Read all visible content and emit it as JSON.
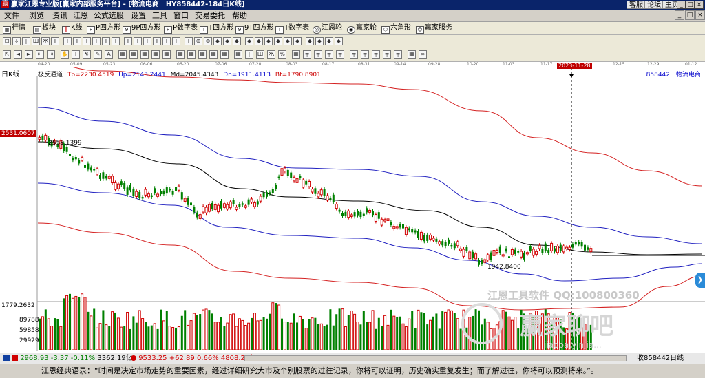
{
  "window": {
    "title": "赢家江恩专业版[赢家内部服务平台] - [物流电商　HY858442-184日K线]",
    "app_icon": "赢",
    "links": [
      "客服",
      "论坛",
      "主页"
    ],
    "controls": [
      "_",
      "□",
      "×"
    ]
  },
  "menu": {
    "items": [
      "文件",
      "浏览",
      "资讯",
      "江恩",
      "公式选股",
      "设置",
      "工具",
      "窗口",
      "交易委托",
      "帮助"
    ],
    "mdi_controls": [
      "_",
      "□",
      "×"
    ]
  },
  "toolbar1": {
    "items": [
      {
        "label": "行情",
        "icon": "quotes-icon"
      },
      {
        "label": "板块",
        "icon": "sector-icon"
      },
      {
        "label": "K线",
        "icon": "kline-icon"
      },
      {
        "label": "P四方形",
        "icon": "square-p-icon"
      },
      {
        "label": "9P四方形",
        "icon": "square-9p-icon"
      },
      {
        "label": "P数字表",
        "icon": "number-table-p-icon"
      },
      {
        "label": "T四方形",
        "icon": "square-t-icon"
      },
      {
        "label": "9T四方形",
        "icon": "square-9t-icon"
      },
      {
        "label": "T数字表",
        "icon": "number-table-t-icon"
      },
      {
        "label": "江恩轮",
        "icon": "gann-wheel-icon"
      },
      {
        "label": "赢家轮",
        "icon": "winner-wheel-icon"
      },
      {
        "label": "六角形",
        "icon": "hexagon-icon"
      },
      {
        "label": "赢家服务",
        "icon": "winner-service-icon"
      }
    ]
  },
  "chart": {
    "period_label": "日K线",
    "indicator_name": "极反通道",
    "indicators": [
      {
        "label": "Tp=2230.4519",
        "color": "#cc0000"
      },
      {
        "label": "Up=2143.2441",
        "color": "#0000cc"
      },
      {
        "label": "Md=2045.4343",
        "color": "#000000"
      },
      {
        "label": "Dn=1911.4113",
        "color": "#0000cc"
      },
      {
        "label": "Bt=1790.8901",
        "color": "#cc0000"
      }
    ],
    "stock_code": "858442　物流电商",
    "current_price_tag": "2531.0607",
    "high_label": "2558.1399",
    "low_label": "1942.8400",
    "cursor_date": "2023-11-28",
    "dates": [
      "04-20",
      "05-09",
      "05-23",
      "06-06",
      "06-20",
      "07-06",
      "07-20",
      "08-03",
      "08-17",
      "08-31",
      "09-14",
      "09-28",
      "10-20",
      "11-03",
      "11-17",
      "2023-11-28",
      "12-15",
      "12-29",
      "01-12"
    ],
    "volume_labels": [
      "1779.2632",
      "89788",
      "59858",
      "29929"
    ],
    "watermark": {
      "line1": "江恩工具软件  QQ:100800360",
      "line2": "赢家聊吧",
      "line3": "jiaoba.yinjia..."
    }
  },
  "status": {
    "index1": {
      "value": "2968.93",
      "change": "-3.37",
      "pct": "-0.11%",
      "amount": "3362.19亿"
    },
    "index2": {
      "value": "9533.25",
      "change": "+62.89",
      "pct": "0.66%",
      "amount": "4808.20亿"
    },
    "right": "收858442日线"
  },
  "quote": "江恩经典语录：“时间是决定市场走势的重要因素，经过详细研究大市及个别股票的过往记录，你将可以证明，历史确实重复发生；而了解过往，你将可以预测将来。”。",
  "colors": {
    "up": "#d00000",
    "down": "#008000",
    "channel_outer": "#d42020",
    "channel_inner": "#2020c0",
    "mid": "#000000"
  }
}
